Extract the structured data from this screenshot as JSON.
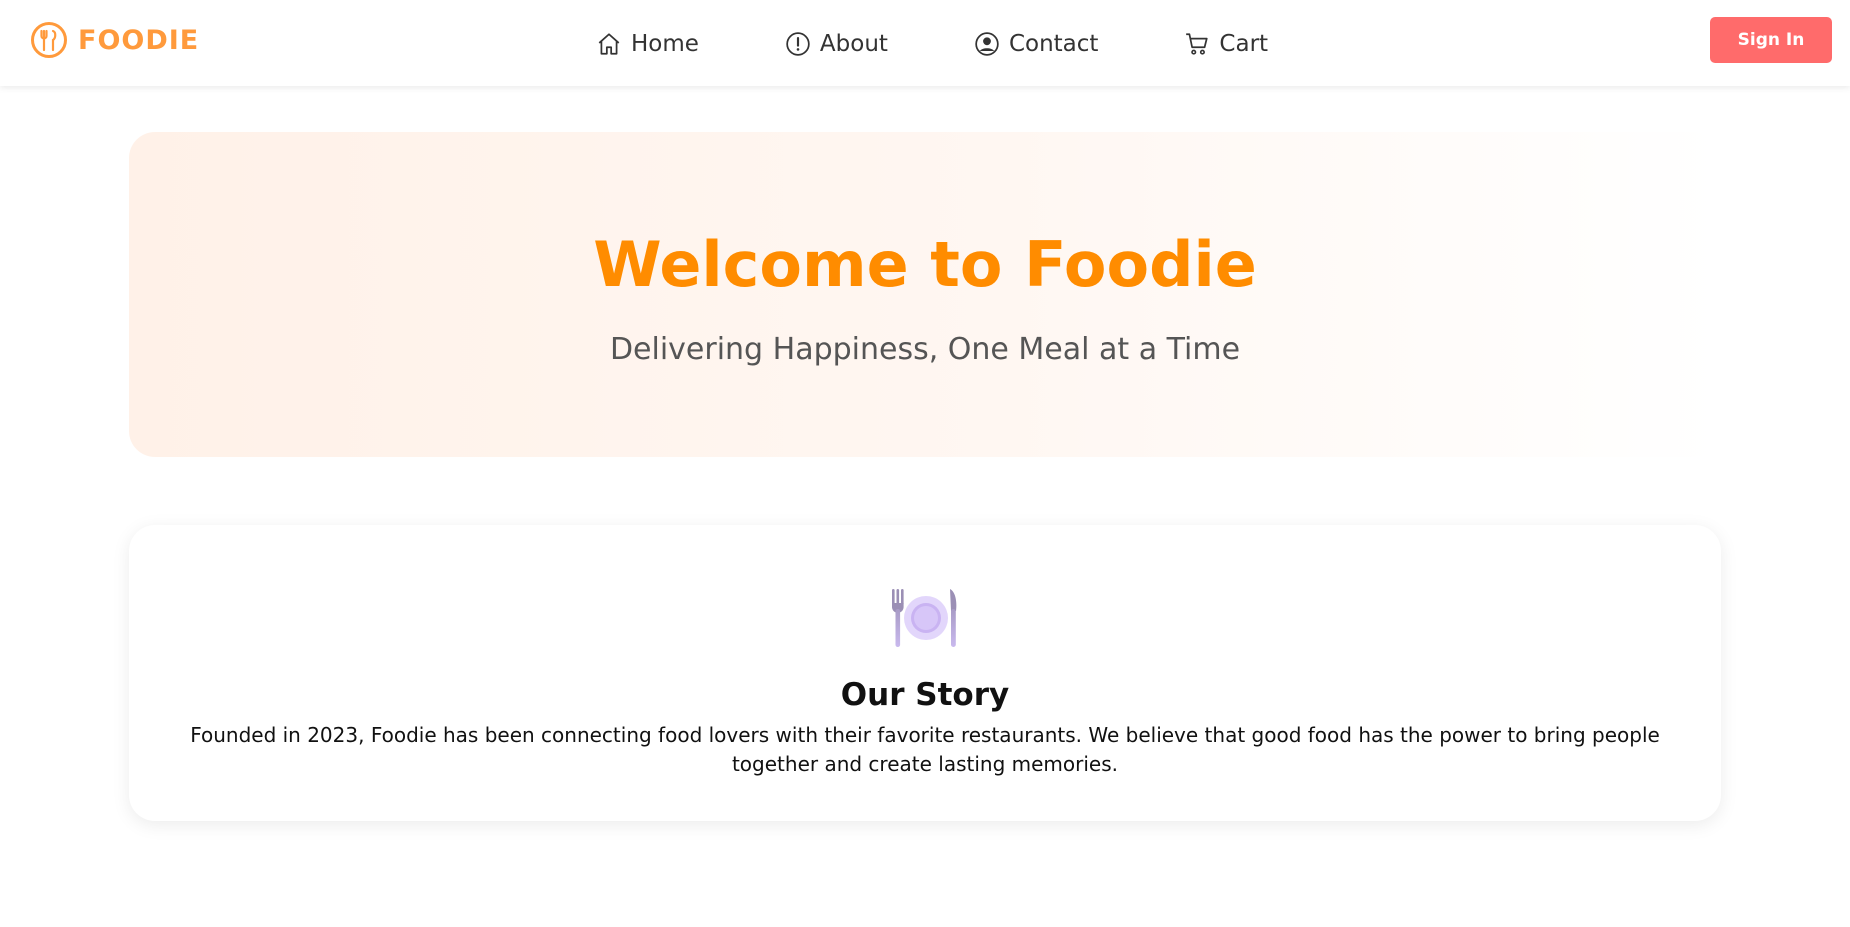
{
  "colors": {
    "brand": "#ff9a3c",
    "hero_title": "#ff8c00",
    "sign_in": "#ff6b6b"
  },
  "header": {
    "logo_text": "FOODIE",
    "nav": [
      {
        "label": "Home",
        "icon": "home-icon"
      },
      {
        "label": "About",
        "icon": "info-icon"
      },
      {
        "label": "Contact",
        "icon": "user-icon"
      },
      {
        "label": "Cart",
        "icon": "cart-icon"
      }
    ],
    "sign_in_label": "Sign In"
  },
  "hero": {
    "title": "Welcome to Foodie",
    "subtitle": "Delivering Happiness, One Meal at a Time"
  },
  "story": {
    "icon": "plate-cutlery-icon",
    "title": "Our Story",
    "text": "Founded in 2023, Foodie has been connecting food lovers with their favorite restaurants. We believe that good food has the power to bring people together and create lasting memories."
  }
}
